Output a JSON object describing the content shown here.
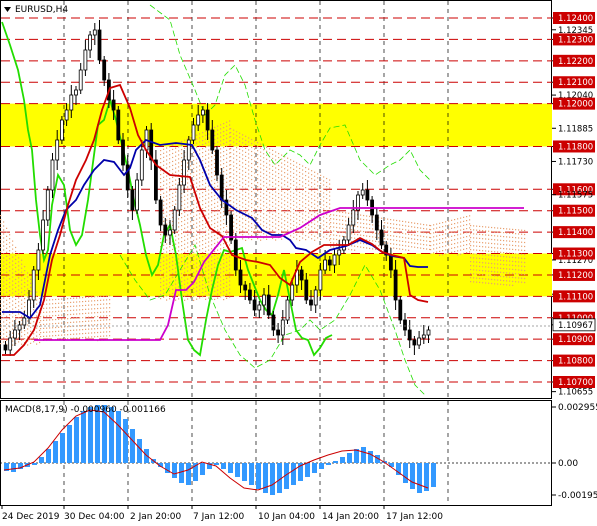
{
  "window": {
    "symbol_label": "EURUSD,H4",
    "menu_arrow": "triangle-down-icon"
  },
  "colors": {
    "background": "#ffffff",
    "zone": "#ffff00",
    "level_line": "#cc0000",
    "price_label_bg": "#cc0000",
    "current_price_bg": "#ffffff",
    "candle": "#000000",
    "tenkan": "#cc0000",
    "kijun": "#0000aa",
    "chikou": "#22dd00",
    "senkou_b": "#cc00cc",
    "bands": "#22dd00",
    "cloud_dots": "#e8a070",
    "macd_hist": "#3399ff",
    "macd_signal": "#cc0000"
  },
  "price_axis": {
    "labels": [
      "1.12400",
      "1.12345",
      "1.12300",
      "1.12200",
      "1.12100",
      "1.12040",
      "1.12000",
      "1.11885",
      "1.11800",
      "1.11730",
      "1.11600",
      "1.11575",
      "1.11500",
      "1.11400",
      "1.11270",
      "1.11300",
      "1.11200",
      "1.11110",
      "1.11100",
      "1.11000",
      "1.10967",
      "1.10900",
      "1.10800",
      "1.10700",
      "1.10655"
    ]
  },
  "levels": {
    "highlighted": [
      "1.12400",
      "1.12300",
      "1.12200",
      "1.12100",
      "1.12000",
      "1.11800",
      "1.11600",
      "1.11500",
      "1.11400",
      "1.11300",
      "1.11200",
      "1.11100",
      "1.11000",
      "1.10900",
      "1.10800",
      "1.10700"
    ],
    "current_price": "1.10967"
  },
  "zones": [
    {
      "from": 1.118,
      "to": 1.12
    },
    {
      "from": 1.111,
      "to": 1.113
    }
  ],
  "macd": {
    "label": "MACD(8,17,9) -0.000960 -0.001166",
    "axis_labels": [
      "0.002955",
      "0.00",
      "-0.001955"
    ]
  },
  "time_axis": {
    "labels": [
      "24 Dec 2019",
      "30 Dec 04:00",
      "2 Jan 20:00",
      "7 Jan 12:00",
      "10 Jan 04:00",
      "14 Jan 20:00",
      "17 Jan 12:00"
    ]
  }
}
